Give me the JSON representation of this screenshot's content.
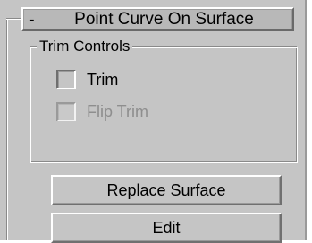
{
  "rollout": {
    "collapse_symbol": "-",
    "title": "Point Curve On Surface"
  },
  "trim_controls": {
    "label": "Trim Controls",
    "trim": {
      "label": "Trim",
      "checked": false,
      "enabled": true
    },
    "flip_trim": {
      "label": "Flip Trim",
      "checked": false,
      "enabled": false
    }
  },
  "buttons": {
    "replace_surface": "Replace Surface",
    "edit": "Edit"
  }
}
